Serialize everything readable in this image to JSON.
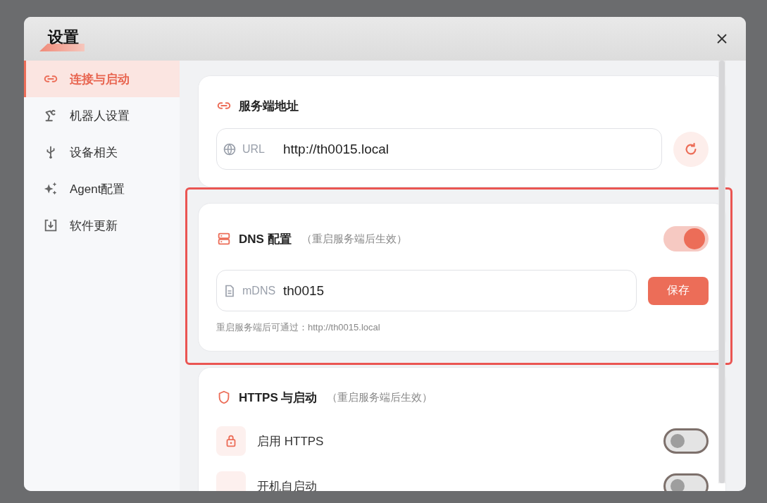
{
  "window": {
    "title": "设置"
  },
  "sidebar": {
    "items": [
      {
        "label": "连接与启动",
        "selected": true
      },
      {
        "label": "机器人设置",
        "selected": false
      },
      {
        "label": "设备相关",
        "selected": false
      },
      {
        "label": "Agent配置",
        "selected": false
      },
      {
        "label": "软件更新",
        "selected": false
      }
    ]
  },
  "sections": [
    {
      "kind": "address",
      "title": "服务端地址",
      "field": {
        "label": "URL",
        "value": "http://th0015.local"
      }
    },
    {
      "kind": "dns",
      "title": "DNS 配置",
      "note": "（重启服务端后生效）",
      "on": true,
      "highlighted": true,
      "field": {
        "label": "mDNS",
        "value": "th0015"
      },
      "button": "保存",
      "hint": "重启服务端后可通过：http://th0015.local"
    },
    {
      "kind": "startup",
      "title": "HTTPS 与启动",
      "note": "（重启服务端后生效）",
      "rows": [
        {
          "label": "启用 HTTPS",
          "on": false
        },
        {
          "label": "开机自启动",
          "on": false
        }
      ]
    }
  ]
}
